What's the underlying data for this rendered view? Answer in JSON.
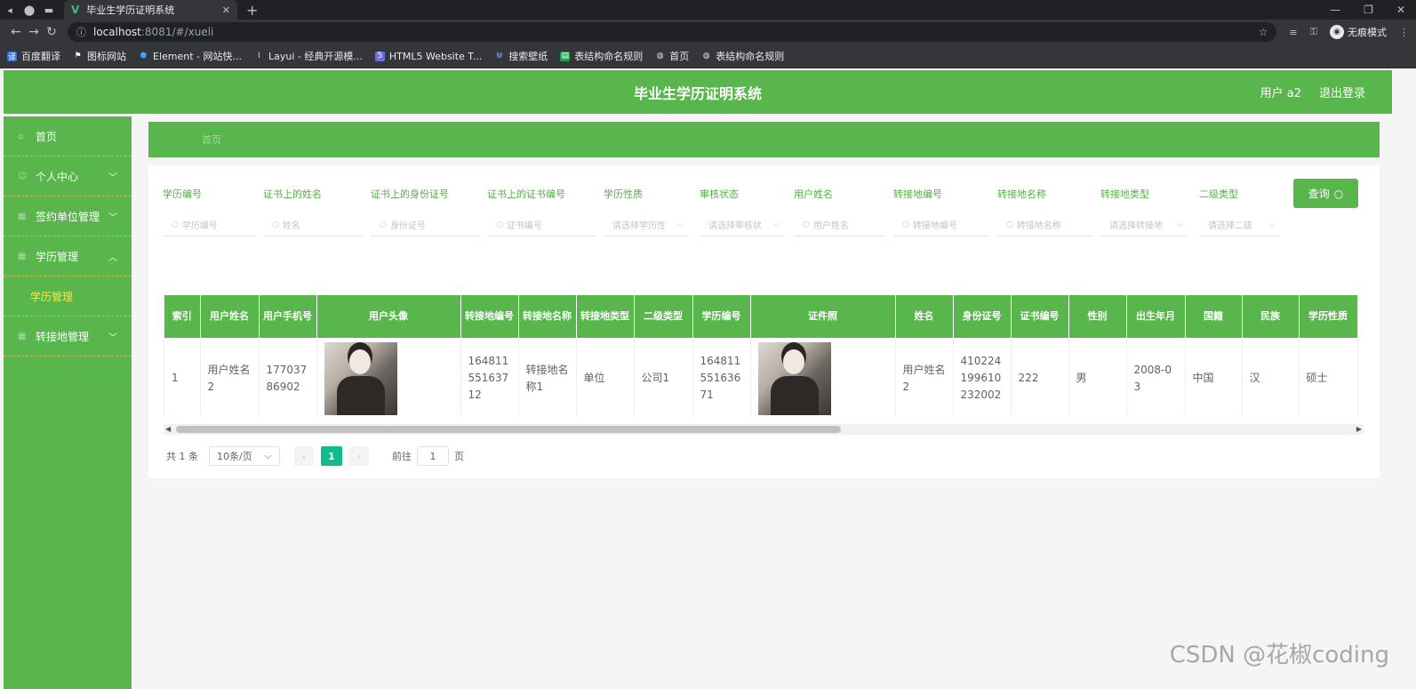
{
  "browser": {
    "tab_title": "毕业生学历证明系统",
    "url_host": "localhost",
    "url_path": ":8081/#/xueli",
    "incognito_label": "无痕模式",
    "bookmarks": [
      "百度翻译",
      "图标网站",
      "Element - 网站快...",
      "Layui - 经典开源模...",
      "HTML5 Website T...",
      "搜索壁纸",
      "表结构命名规则",
      "首页",
      "表结构命名规则"
    ]
  },
  "header": {
    "title": "毕业生学历证明系统",
    "user": "用户 a2",
    "logout": "退出登录"
  },
  "sidebar": {
    "items": [
      {
        "label": "首页"
      },
      {
        "label": "个人中心"
      },
      {
        "label": "签约单位管理"
      },
      {
        "label": "学历管理"
      },
      {
        "label": "学历管理"
      },
      {
        "label": "转接地管理"
      }
    ]
  },
  "breadcrumb": "首页",
  "filters": [
    {
      "label": "学历编号",
      "placeholder": "学历编号"
    },
    {
      "label": "证书上的姓名",
      "placeholder": "姓名"
    },
    {
      "label": "证书上的身份证号",
      "placeholder": "身份证号"
    },
    {
      "label": "证书上的证书编号",
      "placeholder": "证书编号"
    },
    {
      "label": "学历性质",
      "placeholder": "请选择学历性"
    },
    {
      "label": "审核状态",
      "placeholder": "请选择审核状"
    },
    {
      "label": "用户姓名",
      "placeholder": "用户姓名"
    },
    {
      "label": "转接地编号",
      "placeholder": "转接地编号"
    },
    {
      "label": "转接地名称",
      "placeholder": "转接地名称"
    },
    {
      "label": "转接地类型",
      "placeholder": "请选择转接地"
    },
    {
      "label": "二级类型",
      "placeholder": "请选择二级"
    }
  ],
  "query_button": "查询",
  "table": {
    "headers": [
      "索引",
      "用户姓名",
      "用户手机号",
      "用户头像",
      "转接地编号",
      "转接地名称",
      "转接地类型",
      "二级类型",
      "学历编号",
      "证件照",
      "姓名",
      "身份证号",
      "证书编号",
      "性别",
      "出生年月",
      "国籍",
      "民族",
      "学历性质"
    ],
    "row": {
      "index": "1",
      "user_name": "用户姓名2",
      "phone": "17703786902",
      "transfer_no": "16481155163712",
      "transfer_name": "转接地名称1",
      "transfer_type": "单位",
      "sub_type": "公司1",
      "edu_no": "16481155163671",
      "name": "用户姓名2",
      "id_no": "410224199610232002",
      "cert_no": "222",
      "gender": "男",
      "birth": "2008-03",
      "nationality": "中国",
      "ethnicity": "汉",
      "edu_type": "硕士"
    }
  },
  "pagination": {
    "total": "共 1 条",
    "page_size": "10条/页",
    "current": "1",
    "goto_label": "前往",
    "goto_value": "1",
    "goto_unit": "页"
  },
  "watermark": "CSDN @花椒coding",
  "colors": {
    "primary_green": "#58b64d",
    "page_active": "#13b98f",
    "submenu_active": "#f6e84a"
  }
}
